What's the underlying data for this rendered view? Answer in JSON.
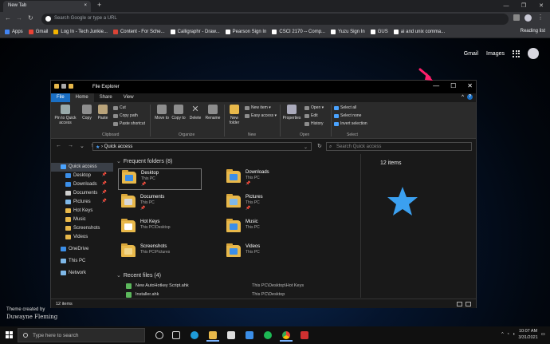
{
  "chrome": {
    "tab_title": "New Tab",
    "tab_close": "×",
    "new_tab": "+",
    "omnibox_placeholder": "Search Google or type a URL",
    "bookmarks": [
      {
        "label": "Apps",
        "color": "#4285f4"
      },
      {
        "label": "Gmail",
        "color": "#ea4335"
      },
      {
        "label": "Log In - Tech Junkie...",
        "color": "#f4b400"
      },
      {
        "label": "Content - For Sche...",
        "color": "#db4437"
      },
      {
        "label": "Calligraphr - Draw...",
        "color": "#ffffff"
      },
      {
        "label": "Pearson Sign In",
        "color": "#ffffff"
      },
      {
        "label": "CSCI 2170 -- Comp...",
        "color": "#ffffff"
      },
      {
        "label": "Yuzu Sign In",
        "color": "#ffffff"
      },
      {
        "label": "GUS",
        "color": "#ffffff"
      },
      {
        "label": "ai and unix comma...",
        "color": "#ffffff"
      }
    ],
    "reading_list": "Reading list"
  },
  "google": {
    "gmail": "Gmail",
    "images": "Images"
  },
  "theme": {
    "line1": "Theme created by",
    "author": "Duwayne Fleming"
  },
  "explorer": {
    "title": "File Explorer",
    "ribbon_tabs": [
      "File",
      "Home",
      "Share",
      "View"
    ],
    "clipboard": {
      "pin": "Pin to Quick access",
      "copy": "Copy",
      "paste": "Paste",
      "cut": "Cut",
      "copy_path": "Copy path",
      "paste_shortcut": "Paste shortcut",
      "group": "Clipboard"
    },
    "organize": {
      "move_to": "Move to",
      "copy_to": "Copy to",
      "delete": "Delete",
      "rename": "Rename",
      "group": "Organize"
    },
    "new_group": {
      "new_folder": "New folder",
      "new_item": "New item ▾",
      "easy_access": "Easy access ▾",
      "group": "New"
    },
    "open_group": {
      "properties": "Properties",
      "open": "Open ▾",
      "edit": "Edit",
      "history": "History",
      "group": "Open"
    },
    "select_group": {
      "select_all": "Select all",
      "select_none": "Select none",
      "invert": "Invert selection",
      "group": "Select"
    },
    "address": "Quick access",
    "search_placeholder": "Search Quick access",
    "nav": [
      {
        "label": "Quick access",
        "color": "#4aa3ff",
        "pin": ""
      },
      {
        "label": "Desktop",
        "color": "#3b8ee8",
        "pin": "📌"
      },
      {
        "label": "Downloads",
        "color": "#3b8ee8",
        "pin": "📌"
      },
      {
        "label": "Documents",
        "color": "#cfcfcf",
        "pin": "📌"
      },
      {
        "label": "Pictures",
        "color": "#7fb8e8",
        "pin": "📌"
      },
      {
        "label": "Hot Keys",
        "color": "#e8b84a",
        "pin": ""
      },
      {
        "label": "Music",
        "color": "#e8b84a",
        "pin": ""
      },
      {
        "label": "Screenshots",
        "color": "#e8b84a",
        "pin": ""
      },
      {
        "label": "Videos",
        "color": "#e8b84a",
        "pin": ""
      },
      {
        "label": "OneDrive",
        "color": "#3b8ee8",
        "pin": ""
      },
      {
        "label": "This PC",
        "color": "#7fb8e8",
        "pin": ""
      },
      {
        "label": "Network",
        "color": "#7fb8e8",
        "pin": ""
      }
    ],
    "frequent_header": "Frequent folders (8)",
    "folders": [
      {
        "name": "Desktop",
        "loc": "This PC",
        "pin": "📌",
        "overlay": "#3b8ee8"
      },
      {
        "name": "Downloads",
        "loc": "This PC",
        "pin": "📌",
        "overlay": "#3b8ee8"
      },
      {
        "name": "Documents",
        "loc": "This PC",
        "pin": "📌",
        "overlay": "#d8d8d8"
      },
      {
        "name": "Pictures",
        "loc": "This PC",
        "pin": "📌",
        "overlay": "#7fb8e8"
      },
      {
        "name": "Hot Keys",
        "loc": "This PC\\Desktop",
        "pin": "",
        "overlay": "#ffffff"
      },
      {
        "name": "Music",
        "loc": "This PC",
        "pin": "",
        "overlay": "#3b8ee8"
      },
      {
        "name": "Screenshots",
        "loc": "This PC\\Pictures",
        "pin": "",
        "overlay": "#f0d58a"
      },
      {
        "name": "Videos",
        "loc": "This PC",
        "pin": "",
        "overlay": "#3b8ee8"
      }
    ],
    "recent_header": "Recent files (4)",
    "recent": [
      {
        "name": "New AutoHotkey Script.ahk",
        "path": "This PC\\Desktop\\Hot Keys"
      },
      {
        "name": "Installer.ahk",
        "path": "This PC\\Desktop"
      }
    ],
    "detail_count": "12 items",
    "status": "12 items"
  },
  "taskbar": {
    "search_placeholder": "Type here to search",
    "time": "10:07 AM",
    "date": "3/31/2021"
  }
}
